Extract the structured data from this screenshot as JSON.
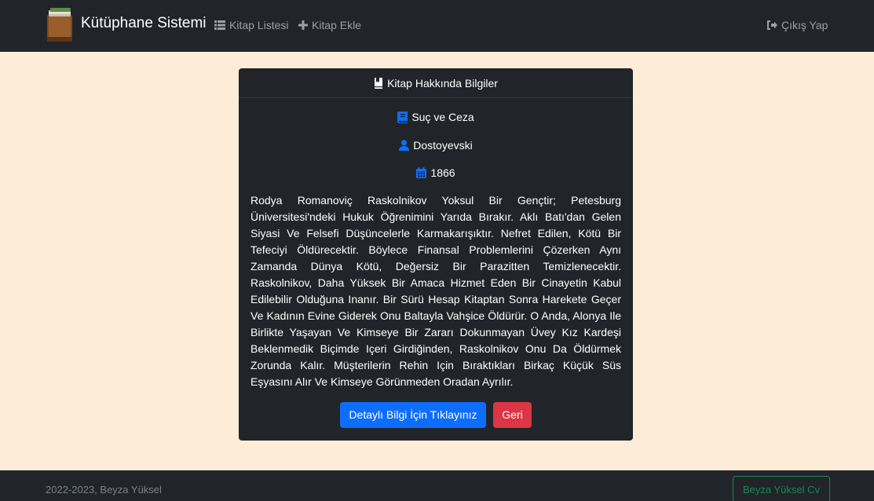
{
  "navbar": {
    "brand": "Kütüphane Sistemi",
    "links": [
      {
        "label": "Kitap Listesi",
        "icon": "list-icon"
      },
      {
        "label": "Kitap Ekle",
        "icon": "plus-icon"
      }
    ],
    "logout": {
      "label": "Çıkış Yap",
      "icon": "sign-out-icon"
    }
  },
  "card": {
    "header": "Kitap Hakkında Bilgiler",
    "title": "Suç ve Ceza",
    "author": "Dostoyevski",
    "year": "1866",
    "description": "Rodya Romanoviç Raskolnikov Yoksul Bir Gençtir; Petesburg Üniversitesi'ndeki Hukuk Öğrenimini Yarıda Bırakır. Aklı Batı'dan Gelen Siyasi Ve Felsefi Düşüncelerle Karmakarışıktır. Nefret Edilen, Kötü Bir Tefeciyi Öldürecektir. Böylece Finansal Problemlerini Çözerken Aynı Zamanda Dünya Kötü, Değersiz Bir Parazitten Temizlenecektir. Raskolnikov, Daha Yüksek Bir Amaca Hizmet Eden Bir Cinayetin Kabul Edilebilir Olduğuna Inanır. Bir Sürü Hesap Kitaptan Sonra Harekete Geçer Ve Kadının Evine Giderek Onu Baltayla Vahşice Öldürür. O Anda, Alonya Ile Birlikte Yaşayan Ve Kimseye Bir Zararı Dokunmayan Üvey Kız Kardeşi Beklenmedik Biçimde Içeri Girdiğinden, Raskolnikov Onu Da Öldürmek Zorunda Kalır. Müşterilerin Rehin Için Bıraktıkları Birkaç Küçük Süs Eşyasını Alır Ve Kimseye Görünmeden Oradan Ayrılır.",
    "detail_button": "Detaylı Bilgi İçin Tıklayınız",
    "back_button": "Geri"
  },
  "footer": {
    "copyright": "2022-2023, Beyza Yüksel",
    "cv_button": "Beyza Yüksel Cv"
  },
  "colors": {
    "page_bg": "#fcecd8",
    "dark": "#212529",
    "primary": "#0d6efd",
    "danger": "#dc3545",
    "success": "#198754",
    "icon_blue": "#0d6efd"
  }
}
